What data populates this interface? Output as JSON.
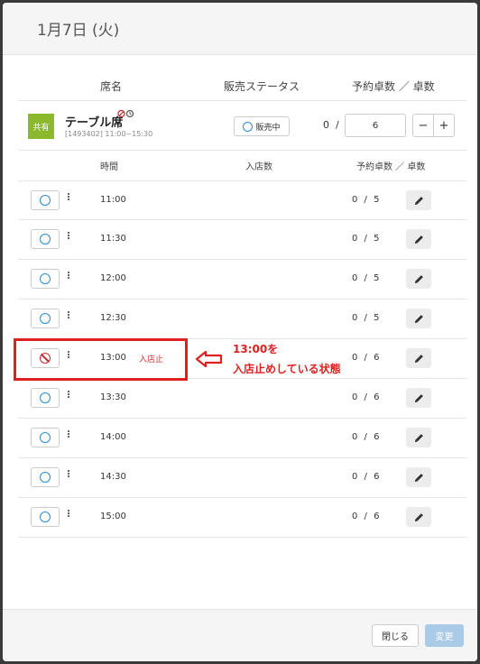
{
  "modal": {
    "title": "1月7日 (火)"
  },
  "table_header": {
    "seat_name": "席名",
    "sales_status": "販売ステータス",
    "reservations": "予約卓数 ／ 卓数"
  },
  "seat": {
    "badge": "共有",
    "name": "テーブル席",
    "sub": "[1493402] 11:00~15:30",
    "status": "販売中",
    "reserved": "0",
    "slash": "/",
    "tables": "6",
    "minus": "−",
    "plus": "+"
  },
  "time_header": {
    "time": "時間",
    "entry_count": "入店数",
    "reservations": "予約卓数 ／ 卓数"
  },
  "time_rows": [
    {
      "time": "11:00",
      "count": "0 / 5",
      "stopped": ""
    },
    {
      "time": "11:30",
      "count": "0 / 5",
      "stopped": ""
    },
    {
      "time": "12:00",
      "count": "0 / 5",
      "stopped": ""
    },
    {
      "time": "12:30",
      "count": "0 / 5",
      "stopped": ""
    },
    {
      "time": "13:00",
      "count": "0 / 6",
      "stopped": "入店止"
    },
    {
      "time": "13:30",
      "count": "0 / 6",
      "stopped": ""
    },
    {
      "time": "14:00",
      "count": "0 / 6",
      "stopped": ""
    },
    {
      "time": "14:30",
      "count": "0 / 6",
      "stopped": ""
    },
    {
      "time": "15:00",
      "count": "0 / 6",
      "stopped": ""
    }
  ],
  "annotation": {
    "line1": "13:00を",
    "line2": "入店止めしている状態"
  },
  "footer": {
    "close": "閉じる",
    "change": "変更"
  },
  "colors": {
    "accent": "#2a8ad0",
    "badge": "#8cb82d",
    "alert": "#e02020",
    "change_button": "#a9cbe8"
  }
}
